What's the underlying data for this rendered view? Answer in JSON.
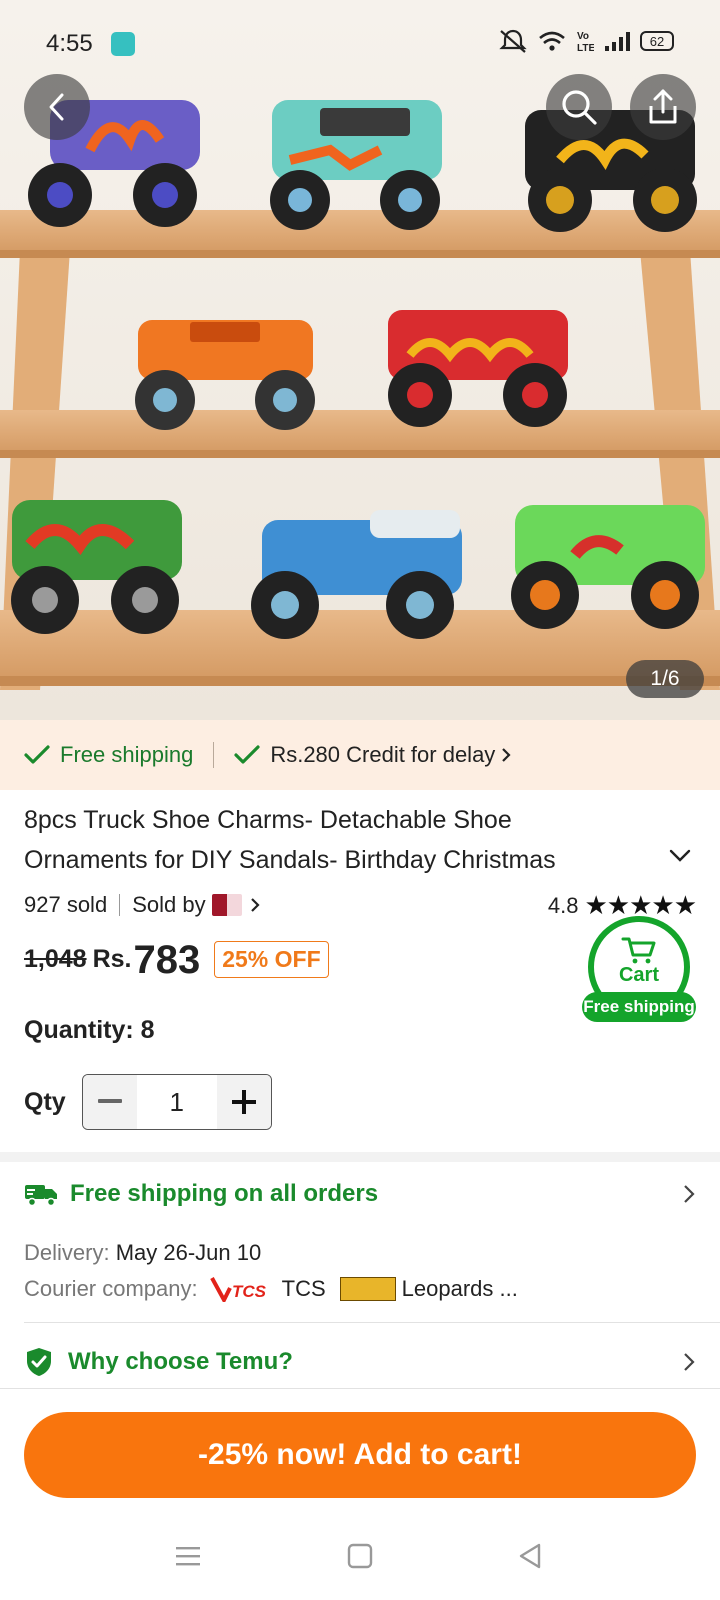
{
  "status_bar": {
    "time": "4:55",
    "battery": "62"
  },
  "gallery": {
    "counter": "1/6"
  },
  "shipping_strip": {
    "free_shipping": "Free shipping",
    "credit": "Rs.280 Credit for delay"
  },
  "product": {
    "title": "8pcs Truck Shoe Charms- Detachable Shoe Ornaments for DIY Sandals- Birthday Christmas",
    "sold": "927 sold",
    "sold_by": "Sold by",
    "rating": "4.8",
    "stars": "★★★★★",
    "original_price": "1,048",
    "currency": "Rs.",
    "price": "783",
    "discount": "25% OFF",
    "quantity_text": "Quantity: 8"
  },
  "cart_widget": {
    "label": "Cart",
    "badge": "Free shipping"
  },
  "qty": {
    "label": "Qty",
    "value": "1",
    "minus": "−",
    "plus": "+"
  },
  "shipping_info": {
    "headline": "Free shipping on all orders",
    "delivery_label": "Delivery:",
    "delivery_value": "May 26-Jun 10",
    "courier_label": "Courier company:",
    "courier_1": "TCS",
    "courier_2": "Leopards ..."
  },
  "why": {
    "label": "Why choose Temu?"
  },
  "cta": {
    "label": "-25% now! Add to cart!"
  },
  "colors": {
    "green": "#1a8a2c",
    "orange": "#f9750d",
    "cart_green": "#14a42b"
  }
}
